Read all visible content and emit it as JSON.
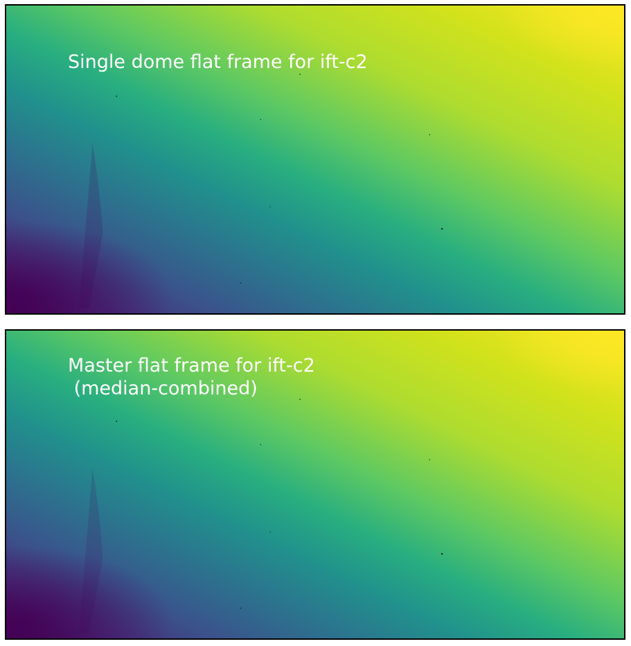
{
  "panels": [
    {
      "label_lines": [
        "Single dome flat frame for ift-c2"
      ],
      "colormap": "viridis"
    },
    {
      "label_lines": [
        "Master flat frame for ift-c2",
        " (median-combined)"
      ],
      "colormap": "viridis"
    }
  ],
  "colors": {
    "viridis_stops": [
      "#440154",
      "#472d7b",
      "#3b528b",
      "#2c728e",
      "#21918c",
      "#28ae80",
      "#5ec962",
      "#addc30",
      "#fde725"
    ],
    "label_text": "#ffffff",
    "frame_border": "#000000"
  }
}
